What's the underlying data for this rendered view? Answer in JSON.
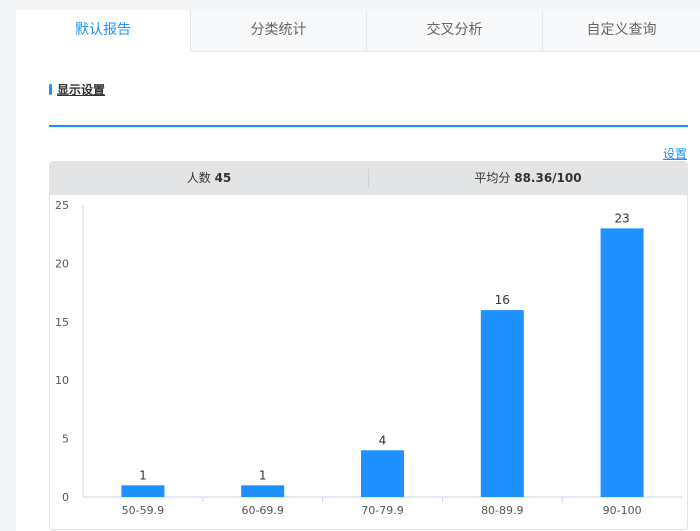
{
  "tabs": [
    "默认报告",
    "分类统计",
    "交叉分析",
    "自定义查询"
  ],
  "active_tab": 0,
  "section": {
    "title": "显示设置"
  },
  "settings_link": "设置",
  "stats": {
    "count_label": "人数",
    "count_value": "45",
    "avg_label": "平均分",
    "avg_value": "88.36/100"
  },
  "colors": {
    "accent": "#1e90ff",
    "bar": "#1e90ff"
  },
  "chart_data": {
    "type": "bar",
    "categories": [
      "50-59.9",
      "60-69.9",
      "70-79.9",
      "80-89.9",
      "90-100"
    ],
    "values": [
      1,
      1,
      4,
      16,
      23
    ],
    "ylim": [
      0,
      25
    ],
    "yticks": [
      0,
      5,
      10,
      15,
      20,
      25
    ],
    "title": "",
    "xlabel": "",
    "ylabel": "",
    "grid": false
  }
}
